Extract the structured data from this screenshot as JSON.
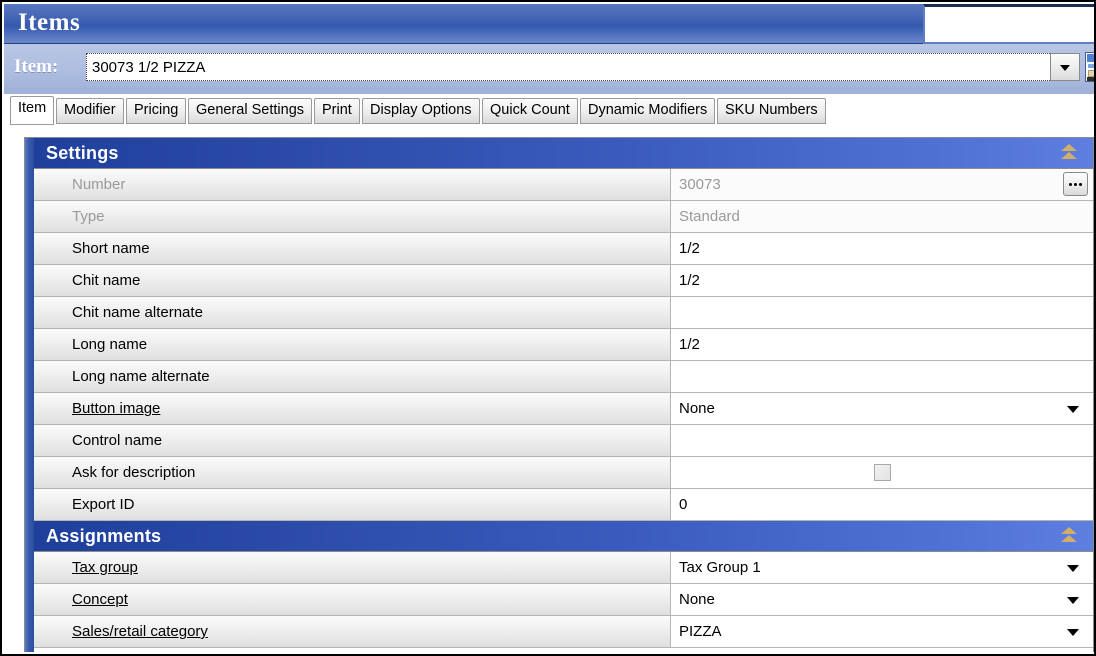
{
  "window": {
    "title": "Items"
  },
  "item_bar": {
    "label": "Item:",
    "value": "30073 1/2 PIZZA",
    "placeholder": "",
    "dropdown_icon": "chevron-down-icon",
    "side_icon": "window-list-icon"
  },
  "tabs": [
    {
      "label": "Item",
      "active": true
    },
    {
      "label": "Modifier",
      "active": false
    },
    {
      "label": "Pricing",
      "active": false
    },
    {
      "label": "General Settings",
      "active": false
    },
    {
      "label": "Print",
      "active": false
    },
    {
      "label": "Display Options",
      "active": false
    },
    {
      "label": "Quick Count",
      "active": false
    },
    {
      "label": "Dynamic Modifiers",
      "active": false
    },
    {
      "label": "SKU Numbers",
      "active": false
    }
  ],
  "sections": [
    {
      "title": "Settings",
      "collapse_icon": "double-chevron-up-icon",
      "rows": [
        {
          "label": "Number",
          "value": "30073",
          "disabled": true,
          "link": false,
          "control": "ellipsis"
        },
        {
          "label": "Type",
          "value": "Standard",
          "disabled": true,
          "link": false,
          "control": "none"
        },
        {
          "label": "Short name",
          "value": "1/2",
          "disabled": false,
          "link": false,
          "control": "none"
        },
        {
          "label": "Chit name",
          "value": "1/2",
          "disabled": false,
          "link": false,
          "control": "none"
        },
        {
          "label": "Chit name alternate",
          "value": "",
          "disabled": false,
          "link": false,
          "control": "none"
        },
        {
          "label": "Long name",
          "value": "1/2",
          "disabled": false,
          "link": false,
          "control": "none"
        },
        {
          "label": "Long name alternate",
          "value": "",
          "disabled": false,
          "link": false,
          "control": "none"
        },
        {
          "label": "Button image",
          "value": "None",
          "disabled": false,
          "link": true,
          "control": "dropdown"
        },
        {
          "label": "Control name",
          "value": "",
          "disabled": false,
          "link": false,
          "control": "none"
        },
        {
          "label": "Ask for description",
          "value": "",
          "disabled": false,
          "link": false,
          "control": "checkbox",
          "checked": false
        },
        {
          "label": "Export ID",
          "value": "0",
          "disabled": false,
          "link": false,
          "control": "none"
        }
      ]
    },
    {
      "title": "Assignments",
      "collapse_icon": "double-chevron-up-icon",
      "rows": [
        {
          "label": "Tax group",
          "value": "Tax Group 1",
          "disabled": false,
          "link": true,
          "control": "dropdown"
        },
        {
          "label": "Concept",
          "value": "None",
          "disabled": false,
          "link": true,
          "control": "dropdown"
        },
        {
          "label": "Sales/retail category",
          "value": "PIZZA",
          "disabled": false,
          "link": true,
          "control": "dropdown"
        }
      ]
    }
  ],
  "colors": {
    "title_blue": "#3e60b0",
    "section_header_start": "#1f3f9c",
    "section_header_end": "#5e7ee0",
    "item_bar": "#aebde0",
    "collapse_gold": "#d2ac6a",
    "label_cell": "#efefef"
  }
}
